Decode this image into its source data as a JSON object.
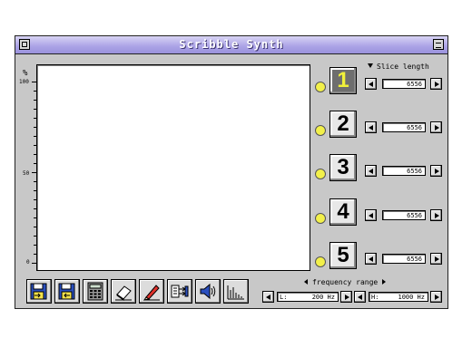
{
  "window": {
    "title": "Scribble Synth"
  },
  "y_axis": {
    "unit": "%",
    "top_label": "100",
    "mid_label": "50",
    "bottom_label": "0"
  },
  "slices": {
    "header": "Slice length",
    "items": [
      {
        "number": "1",
        "value": "6556",
        "active": true
      },
      {
        "number": "2",
        "value": "6556",
        "active": false
      },
      {
        "number": "3",
        "value": "6556",
        "active": false
      },
      {
        "number": "4",
        "value": "6556",
        "active": false
      },
      {
        "number": "5",
        "value": "6556",
        "active": false
      }
    ]
  },
  "toolbar": {
    "buttons": [
      {
        "icon": "save-in-icon"
      },
      {
        "icon": "save-out-icon"
      },
      {
        "icon": "calculator-icon"
      },
      {
        "icon": "eraser-icon"
      },
      {
        "icon": "pencil-icon"
      },
      {
        "icon": "sequence-icon"
      },
      {
        "icon": "speaker-icon"
      },
      {
        "icon": "spectrum-icon"
      }
    ]
  },
  "frequency_range": {
    "label": "frequency range",
    "low_key": "L:",
    "low_value": "200 Hz",
    "high_key": "H:",
    "high_value": "1000 Hz"
  },
  "colors": {
    "titlebar": "#9a92dc",
    "led": "#f2f04a",
    "active_slice_text": "#f0f03a",
    "window_bg": "#c8c8c8"
  }
}
